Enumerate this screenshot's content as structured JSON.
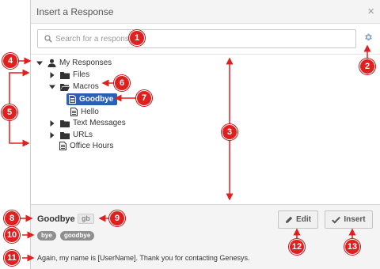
{
  "dialog": {
    "title": "Insert a Response",
    "close_icon": "close-icon"
  },
  "search": {
    "placeholder": "Search for a response"
  },
  "tree": {
    "root": "My Responses",
    "items": {
      "files": "Files",
      "macros": "Macros",
      "goodbye": "Goodbye",
      "hello": "Hello",
      "text_messages": "Text Messages",
      "urls": "URLs",
      "office_hours": "Office Hours"
    }
  },
  "footer": {
    "response_name": "Goodbye",
    "shortcut": "gb",
    "edit_label": "Edit",
    "insert_label": "Insert",
    "tags": [
      "bye",
      "goodbye"
    ],
    "message": "Again, my name is [UserName]. Thank you for contacting Genesys."
  },
  "callouts": [
    "1",
    "2",
    "3",
    "4",
    "5",
    "6",
    "7",
    "8",
    "9",
    "10",
    "11",
    "12",
    "13"
  ],
  "colors": {
    "callout": "#e01f1f",
    "selection": "#2d5fb7",
    "tag": "#8f8f8f"
  }
}
